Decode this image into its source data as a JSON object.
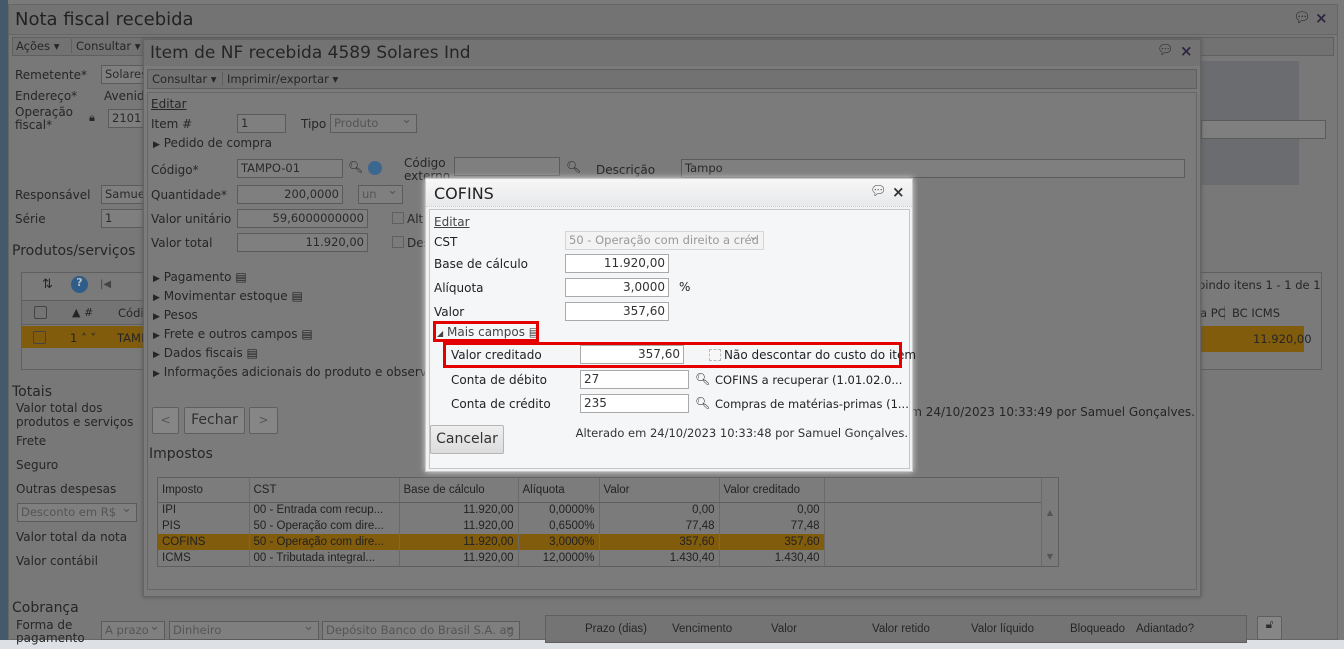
{
  "main_window": {
    "title": "Nota fiscal recebida",
    "menu": [
      "Ações",
      "Consultar"
    ],
    "fields": {
      "remetente_label": "Remetente*",
      "remetente_value": "Solares",
      "endereco_label": "Endereço*",
      "endereco_value": "Avenida",
      "operacao_label": "Operação fiscal*",
      "operacao_value": "2101",
      "responsavel_label": "Responsável",
      "responsavel_value": "Samuel",
      "serie_label": "Série",
      "serie_value": "1"
    },
    "produtos": {
      "title": "Produtos/serviços",
      "paging": "bindo itens 1 - 1 de 1",
      "headers": [
        "#",
        "Códi",
        "a PC",
        "BC ICMS"
      ],
      "row": {
        "num": "1",
        "codigo": "TAMP",
        "bc_icms": "11.920,00"
      }
    },
    "totais": {
      "title": "Totais",
      "labels": [
        "Valor total dos produtos e serviços",
        "Frete",
        "Seguro",
        "Outras despesas"
      ],
      "desconto_select": "Desconto em R$",
      "valor_total_nota": "Valor total da nota",
      "valor_contabil": "Valor contábil"
    },
    "cobranca": {
      "title": "Cobrança",
      "forma_label": "Forma de pagamento",
      "forma": "A prazo",
      "meio": "Dinheiro",
      "conta": "Depósito Banco do Brasil S.A. ag",
      "headers": [
        "Prazo (dias)",
        "Vencimento",
        "Valor",
        "Valor retido",
        "Valor líquido",
        "Bloqueado",
        "Adiantado?"
      ]
    }
  },
  "item_window": {
    "title": "Item de NF recebida 4589 Solares Ind",
    "menu": [
      "Consultar",
      "Imprimir/exportar"
    ],
    "edit_link": "Editar",
    "item_label": "Item #",
    "item_value": "1",
    "tipo_label": "Tipo",
    "tipo_value": "Produto",
    "pedido": "Pedido de compra",
    "codigo_label": "Código*",
    "codigo_value": "TAMPO-01",
    "codigo_externo_label": "Código externo",
    "descricao_label": "Descrição",
    "descricao_value": "Tampo",
    "quantidade_label": "Quantidade*",
    "quantidade_value": "200,0000",
    "unidade": "un",
    "valor_unitario_label": "Valor unitário",
    "valor_unitario_value": "59,6000000000",
    "chk1": "Alt",
    "valor_total_label": "Valor total",
    "valor_total_value": "11.920,00",
    "chk2": "Des",
    "sections": [
      "Pagamento",
      "Movimentar estoque",
      "Pesos",
      "Frete e outros campos",
      "Dados fiscais",
      "Informações adicionais do produto e observações"
    ],
    "prev": "<",
    "close": "Fechar",
    "next": ">",
    "audit": "Alterado em 24/10/2023 10:33:49 por Samuel Gonçalves.",
    "impostos": {
      "title": "Impostos",
      "headers": [
        "Imposto",
        "CST",
        "Base de cálculo",
        "Alíquota",
        "Valor",
        "Valor creditado"
      ],
      "rows": [
        [
          "IPI",
          "00 - Entrada com recup...",
          "11.920,00",
          "0,0000%",
          "0,00",
          "0,00"
        ],
        [
          "PIS",
          "50 - Operação com dire...",
          "11.920,00",
          "0,6500%",
          "77,48",
          "77,48"
        ],
        [
          "COFINS",
          "50 - Operação com dire...",
          "11.920,00",
          "3,0000%",
          "357,60",
          "357,60"
        ],
        [
          "ICMS",
          "00 - Tributada integral...",
          "11.920,00",
          "12,0000%",
          "1.430,40",
          "1.430,40"
        ]
      ]
    }
  },
  "dialog": {
    "title": "COFINS",
    "edit_link": "Editar",
    "cst_label": "CST",
    "cst_value": "50 - Operação com direito a créd",
    "base_label": "Base de cálculo",
    "base_value": "11.920,00",
    "aliquota_label": "Alíquota",
    "aliquota_value": "3,0000",
    "pct": "%",
    "valor_label": "Valor",
    "valor_value": "357,60",
    "mais_campos": "Mais campos",
    "valor_creditado_label": "Valor creditado",
    "valor_creditado_value": "357,60",
    "nao_descontar": "Não descontar do custo do item",
    "debito_label": "Conta de débito",
    "debito_value": "27",
    "debito_desc": "COFINS a recuperar (1.01.02.0...",
    "credito_label": "Conta de crédito",
    "credito_value": "235",
    "credito_desc": "Compras de matérias-primas (1...",
    "cancel": "Cancelar",
    "audit": "Alterado em 24/10/2023 10:33:48 por Samuel Gonçalves.",
    "highlight_color": "#e50000"
  }
}
